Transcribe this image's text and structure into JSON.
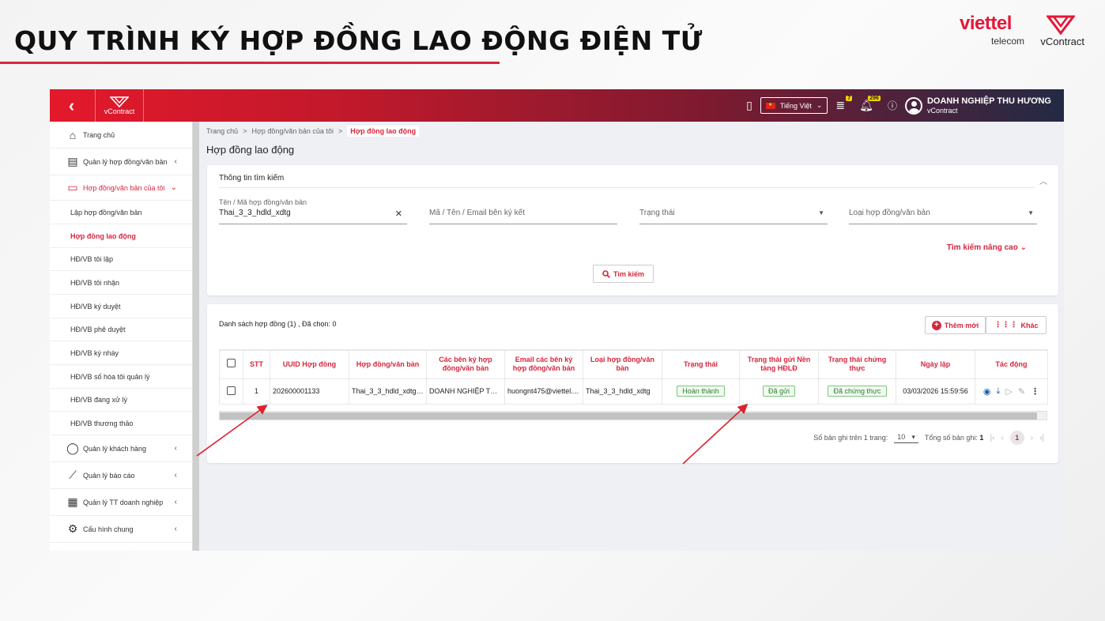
{
  "slide": {
    "title": "QUY TRÌNH KÝ HỢP ĐỒNG LAO ĐỘNG ĐIỆN TỬ",
    "brand": {
      "viettel": "viettel",
      "telecom": "telecom",
      "vcontract": "vContract"
    }
  },
  "topbar": {
    "logo_text": "vContract",
    "language": "Tiếng Việt",
    "notif_count_1": "7",
    "notif_count_2": "296",
    "user_name": "DOANH NGHIỆP THU HƯƠNG",
    "user_sub": "vContract"
  },
  "sidebar": {
    "items": [
      {
        "label": "Trang chủ",
        "icon": "home-icon"
      },
      {
        "label": "Quản lý hợp đồng/văn bản",
        "icon": "document-icon"
      },
      {
        "label": "Hợp đồng/văn bản của tôi",
        "icon": "folder-open-icon"
      },
      {
        "label": "Lập hợp đồng/văn bản"
      },
      {
        "label": "Hợp đồng lao động"
      },
      {
        "label": "HĐ/VB tôi lập"
      },
      {
        "label": "HĐ/VB tôi nhận"
      },
      {
        "label": "HĐ/VB ký duyệt"
      },
      {
        "label": "HĐ/VB phê duyệt"
      },
      {
        "label": "HĐ/VB ký nháy"
      },
      {
        "label": "HĐ/VB số hóa tôi quản lý"
      },
      {
        "label": "HĐ/VB đang xử lý"
      },
      {
        "label": "HĐ/VB thương thảo"
      },
      {
        "label": "Quản lý khách hàng",
        "icon": "user-icon"
      },
      {
        "label": "Quản lý báo cáo",
        "icon": "chart-icon"
      },
      {
        "label": "Quản lý TT doanh nghiệp",
        "icon": "building-icon"
      },
      {
        "label": "Cấu hình chung",
        "icon": "gear-icon"
      }
    ]
  },
  "breadcrumb": [
    "Trang chủ",
    "Hợp đồng/văn bản của tôi",
    "Hợp đồng lao động"
  ],
  "page_title": "Hợp đồng lao động",
  "search": {
    "heading": "Thông tin tìm kiếm",
    "name_label": "Tên / Mã hợp đồng/văn bản",
    "name_value": "Thai_3_3_hdld_xdtg",
    "party_placeholder": "Mã / Tên / Email bên ký kết",
    "status_placeholder": "Trạng thái",
    "type_placeholder": "Loại hợp đồng/văn bản",
    "advanced": "Tìm kiếm nâng cao",
    "button": "Tìm kiếm"
  },
  "list": {
    "heading": "Danh sách hợp đồng (1) , Đã chọn: 0",
    "add_button": "Thêm mới",
    "more_button": "Khác",
    "columns": [
      "STT",
      "UUID Hợp đồng",
      "Hợp đồng/văn bản",
      "Các bên ký hợp đồng/văn bản",
      "Email các bên ký hợp đồng/văn bản",
      "Loại hợp đồng/văn bản",
      "Trạng thái",
      "Trạng thái gửi Nền tảng HĐLĐ",
      "Trạng thái chứng thực",
      "Ngày lập",
      "Tác động"
    ],
    "rows": [
      {
        "stt": "1",
        "uuid": "202600001133",
        "name": "Thai_3_3_hdld_xdtg -...",
        "parties": "DOANH NGHIỆP THU...",
        "emails": "huongnt475@viettel....",
        "type": "Thai_3_3_hdld_xdtg",
        "status": "Hoàn thành",
        "send_status": "Đã gửi",
        "cert_status": "Đã chứng thực",
        "date": "03/03/2026 15:59:56"
      }
    ]
  },
  "pager": {
    "per_page_label": "Số bản ghi trên 1 trang:",
    "per_page": "10",
    "total_label": "Tổng số bản ghi:",
    "total": "1",
    "current_page": "1"
  },
  "colors": {
    "accent": "#d7263d",
    "status_green": "#2e7d32"
  }
}
